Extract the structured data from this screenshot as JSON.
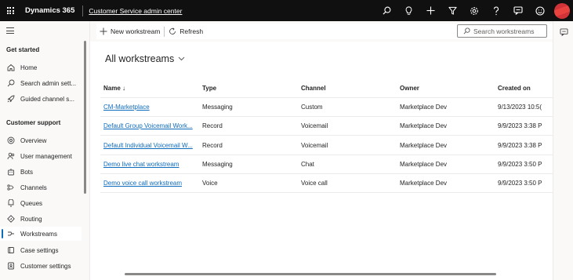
{
  "topbar": {
    "brand": "Dynamics 365",
    "app_name": "Customer Service admin center",
    "icons": [
      "search-icon",
      "lightbulb-icon",
      "plus-icon",
      "filter-icon",
      "settings-icon",
      "help-icon",
      "chat-icon",
      "smiley-icon",
      "avatar"
    ]
  },
  "sidebar": {
    "section1": "Get started",
    "items1": [
      {
        "label": "Home",
        "icon": "home-icon"
      },
      {
        "label": "Search admin sett...",
        "icon": "search-icon"
      },
      {
        "label": "Guided channel s...",
        "icon": "rocket-icon"
      }
    ],
    "section2": "Customer support",
    "items2": [
      {
        "label": "Overview",
        "icon": "overview-icon"
      },
      {
        "label": "User management",
        "icon": "people-icon"
      },
      {
        "label": "Bots",
        "icon": "bot-icon"
      },
      {
        "label": "Channels",
        "icon": "channels-icon"
      },
      {
        "label": "Queues",
        "icon": "queue-icon"
      },
      {
        "label": "Routing",
        "icon": "routing-icon"
      },
      {
        "label": "Workstreams",
        "icon": "workstream-icon",
        "active": true
      },
      {
        "label": "Case settings",
        "icon": "case-icon"
      },
      {
        "label": "Customer settings",
        "icon": "customer-icon"
      }
    ]
  },
  "commandbar": {
    "new_label": "New workstream",
    "refresh_label": "Refresh",
    "search_placeholder": "Search workstreams"
  },
  "view": {
    "title": "All workstreams"
  },
  "grid": {
    "columns": [
      "Name ↓",
      "Type",
      "Channel",
      "Owner",
      "Created on"
    ],
    "rows": [
      [
        "CM-Marketplace",
        "Messaging",
        "Custom",
        "Marketplace Dev",
        "9/13/2023 10:5("
      ],
      [
        "Default Group Voicemail Work...",
        "Record",
        "Voicemail",
        "Marketplace Dev",
        "9/9/2023 3:38 P"
      ],
      [
        "Default Individual Voicemail W...",
        "Record",
        "Voicemail",
        "Marketplace Dev",
        "9/9/2023 3:38 P"
      ],
      [
        "Demo live chat workstream",
        "Messaging",
        "Chat",
        "Marketplace Dev",
        "9/9/2023 3:50 P"
      ],
      [
        "Demo voice call workstream",
        "Voice",
        "Voice call",
        "Marketplace Dev",
        "9/9/2023 3:50 P"
      ]
    ]
  },
  "colors": {
    "topbar": "#101010",
    "accent": "#0f6cbd",
    "avatar": "#d13438"
  }
}
